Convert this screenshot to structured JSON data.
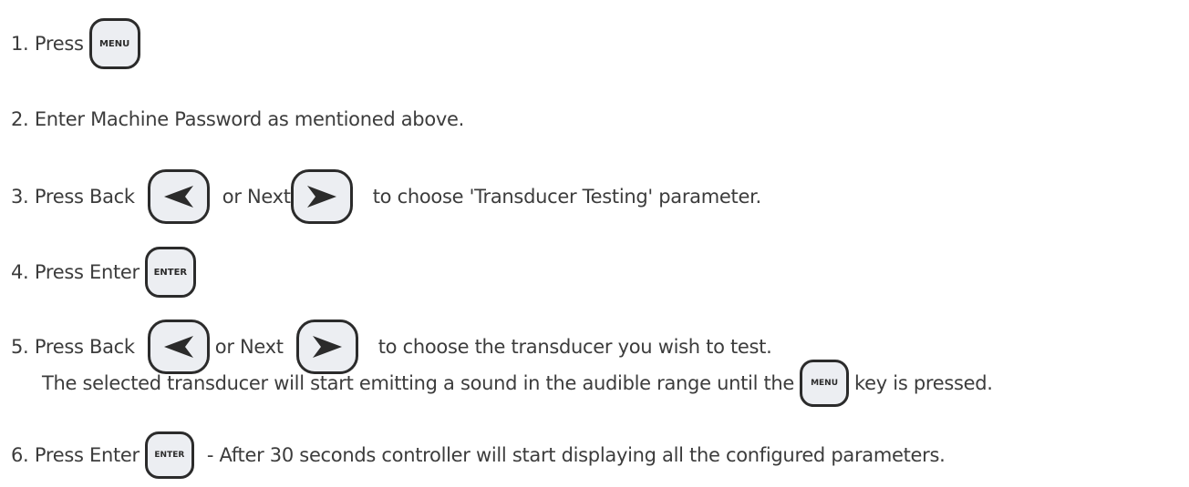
{
  "steps": [
    {
      "number": "1.",
      "text": "Press",
      "key": "MENU"
    },
    {
      "number": "2.",
      "text": "Enter Machine Password as mentioned above."
    },
    {
      "number": "3.",
      "text_before": "Press Back",
      "text_mid": "or Next",
      "text_after": "to choose 'Transducer Testing' parameter."
    },
    {
      "number": "4.",
      "text": "Press Enter",
      "key": "ENTER"
    },
    {
      "number": "5.",
      "text_before": "Press Back",
      "text_mid": "or Next",
      "text_after": "to choose the transducer you wish to test.",
      "line2_before": "The selected transducer will start emitting a sound in the audible range until the",
      "line2_key": "MENU",
      "line2_after": "key is pressed."
    },
    {
      "number": "6.",
      "text": "Press Enter",
      "key": "ENTER",
      "text_after": "- After 30 seconds controller will start displaying all the configured parameters."
    }
  ],
  "icons": {
    "back": "left-arrow-icon",
    "next": "right-arrow-icon"
  },
  "colors": {
    "text": "#3c3c3c",
    "key_border": "#2b2b2b",
    "key_fill": "#eceef2"
  }
}
